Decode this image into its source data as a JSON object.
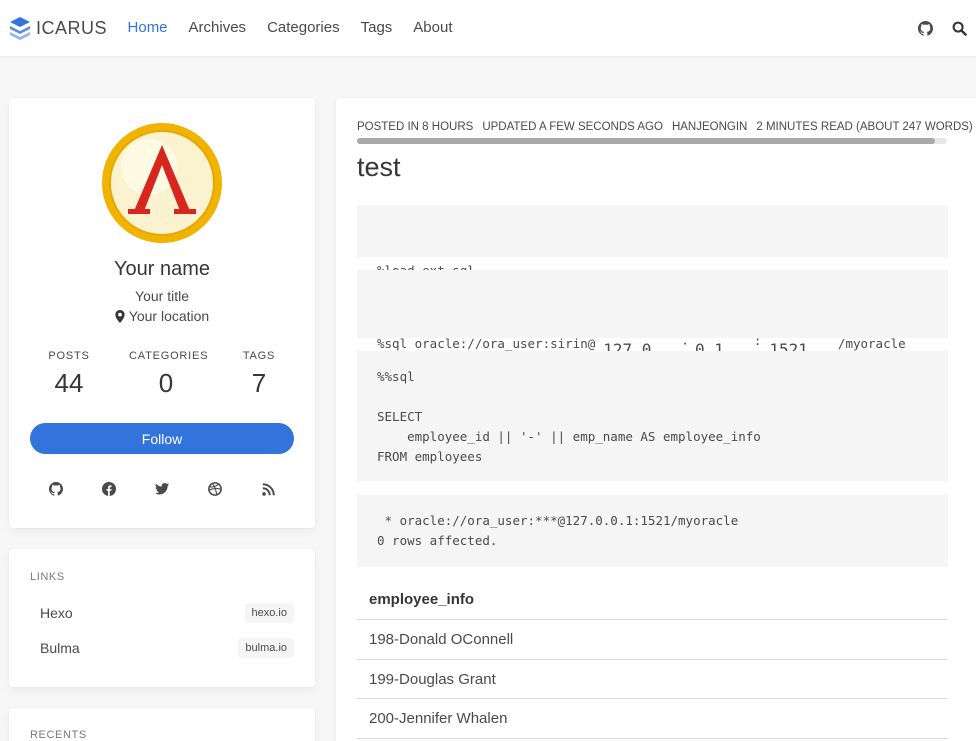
{
  "navbar": {
    "brand": "ICARUS",
    "items": [
      {
        "label": "Home",
        "active": true
      },
      {
        "label": "Archives",
        "active": false
      },
      {
        "label": "Categories",
        "active": false
      },
      {
        "label": "Tags",
        "active": false
      },
      {
        "label": "About",
        "active": false
      }
    ],
    "right_icons": [
      "github-icon",
      "search-icon"
    ]
  },
  "profile": {
    "name": "Your name",
    "title": "Your title",
    "location": "Your location",
    "stats": [
      {
        "label": "POSTS",
        "value": "44"
      },
      {
        "label": "CATEGORIES",
        "value": "0"
      },
      {
        "label": "TAGS",
        "value": "7"
      }
    ],
    "follow_label": "Follow",
    "socials": [
      "github-icon",
      "facebook-icon",
      "twitter-icon",
      "dribbble-icon",
      "rss-icon"
    ]
  },
  "links": {
    "title": "LINKS",
    "items": [
      {
        "name": "Hexo",
        "tag": "hexo.io"
      },
      {
        "name": "Bulma",
        "tag": "bulma.io"
      }
    ]
  },
  "recents": {
    "title": "RECENTS"
  },
  "article": {
    "meta": [
      "POSTED IN 8 HOURS",
      "UPDATED A FEW SECONDS AGO",
      "HANJEONGIN",
      "2 MINUTES READ (ABOUT 247 WORDS)"
    ],
    "title": "test",
    "code1": "%load_ext sql",
    "code2_prefix": "%sql oracle://ora_user:sirin@",
    "code2_ip1": "127.0",
    "code2_dot": "·",
    "code2_ip2": "0.1",
    "code2_colon": ":",
    "code2_port": "1521",
    "code2_suffix": "/myoracle",
    "code3": "%%sql\n\nSELECT\n    employee_id || '-' || emp_name AS employee_info\nFROM employees",
    "code4": " * oracle://ora_user:***@127.0.0.1:1521/myoracle\n0 rows affected.",
    "table_header": "employee_info",
    "table_rows": [
      "198-Donald OConnell",
      "199-Douglas Grant",
      "200-Jennifer Whalen"
    ]
  },
  "colors": {
    "accent": "#3273dc",
    "background": "#f7f7f7"
  }
}
